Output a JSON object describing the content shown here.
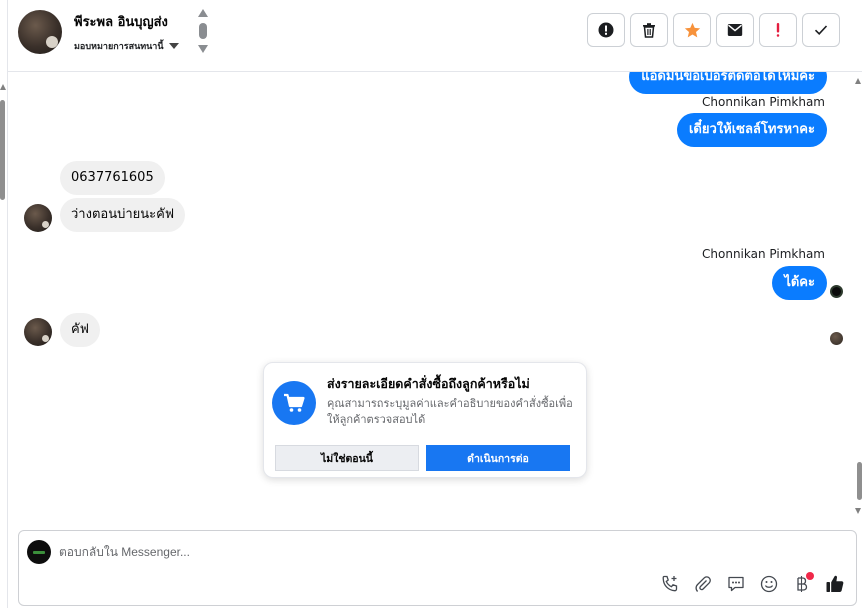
{
  "header": {
    "contact_name": "พีระพล อินบุญส่ง",
    "assign_label": "มอบหมายการสนทนานี้",
    "tools": [
      {
        "name": "mark-spam",
        "icon": "alert-circle-icon"
      },
      {
        "name": "delete",
        "icon": "trash-icon"
      },
      {
        "name": "star",
        "icon": "star-icon",
        "color": "#f7923b"
      },
      {
        "name": "mark-unread",
        "icon": "envelope-icon"
      },
      {
        "name": "follow-up",
        "icon": "exclamation-icon",
        "color": "#e41e3f"
      },
      {
        "name": "mark-done",
        "icon": "check-icon"
      }
    ]
  },
  "messages": {
    "out_1": "แอดมินขอเบอร์ติดต่อได้ไหมคะ",
    "sender_1": "Chonnikan Pimkham",
    "out_2": "เดี๋ยวให้เซลล์โทรหาคะ",
    "in_1": "0637761605",
    "in_2": "ว่างตอนบ่ายนะคัฟ",
    "sender_2": "Chonnikan Pimkham",
    "out_3": "ได้คะ",
    "in_3": "คัฟ"
  },
  "prompt_card": {
    "title": "ส่งรายละเอียดคำสั่งซื้อถึงลูกค้าหรือไม่",
    "description": "คุณสามารถระบุมูลค่าและคำอธิบายของคำสั่งซื้อเพื่อให้ลูกค้าตรวจสอบได้",
    "secondary_button": "ไม่ใช่ตอนนี้",
    "primary_button": "ดำเนินการต่อ"
  },
  "composer": {
    "placeholder": "ตอบกลับใน Messenger...",
    "tools": [
      "phone-add-icon",
      "paperclip-icon",
      "saved-reply-icon",
      "emoji-icon",
      "baht-payment-icon",
      "like-icon"
    ]
  },
  "colors": {
    "accent": "#0a7cff",
    "brand": "#1877f2",
    "incoming_bubble": "#f0f0f0"
  }
}
